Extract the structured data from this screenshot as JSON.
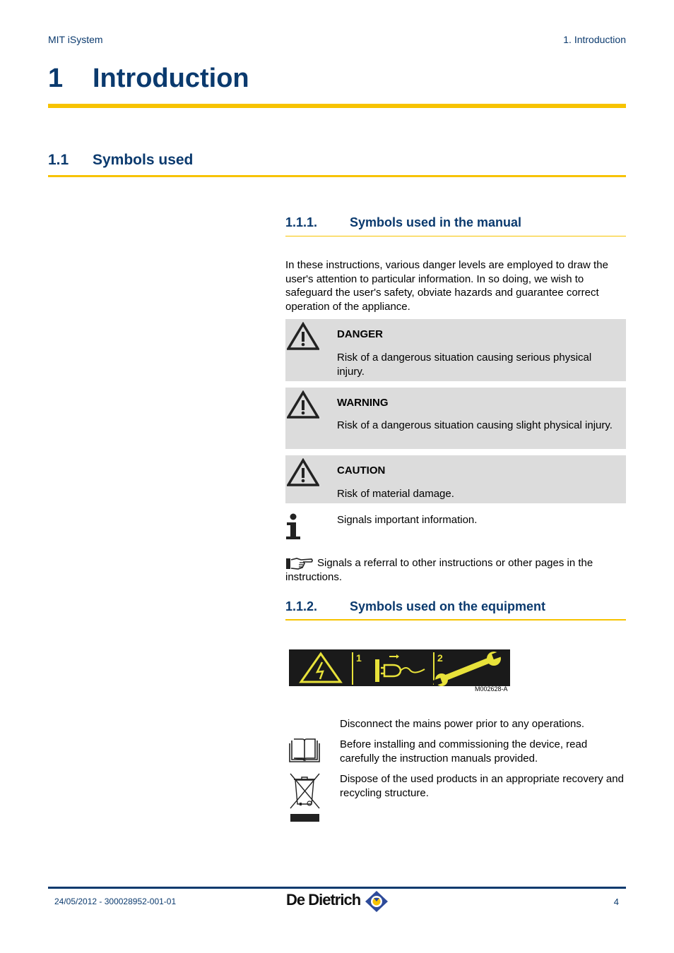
{
  "header": {
    "product": "MIT iSystem",
    "chapter": "1.  Introduction"
  },
  "chapter": {
    "number": "1",
    "title": "Introduction"
  },
  "section": {
    "number": "1.1",
    "title": "Symbols used"
  },
  "subsection1": {
    "number": "1.1.1.",
    "title": "Symbols used in the manual",
    "intro": "In these instructions, various danger levels are employed to draw the user's attention to particular information. In so doing, we wish to safeguard the user's safety, obviate hazards and guarantee correct operation of the appliance.",
    "notices": [
      {
        "icon": "warning-triangle-icon",
        "title": "DANGER",
        "text": "Risk of a dangerous situation causing serious physical injury."
      },
      {
        "icon": "warning-triangle-icon",
        "title": "WARNING",
        "text": "Risk of a dangerous situation causing slight physical injury."
      },
      {
        "icon": "warning-triangle-icon",
        "title": "CAUTION",
        "text": "Risk of material damage."
      }
    ],
    "info": {
      "icon": "info-icon",
      "text": "Signals important information."
    },
    "referral": {
      "icon": "pointing-hand-icon",
      "text": "Signals a referral to other instructions or other pages in the instructions."
    }
  },
  "subsection2": {
    "number": "1.1.2.",
    "title": "Symbols used on the equipment",
    "figure": {
      "label1": "1",
      "label2": "2",
      "code": "M002628-A",
      "colors": {
        "background": "#1a1a1a",
        "symbol": "#e8e23a"
      }
    },
    "items": [
      {
        "icon": "",
        "text": "Disconnect the mains power prior to any operations."
      },
      {
        "icon": "book-icon",
        "text": "Before installing and commissioning the device, read carefully the instruction manuals provided."
      },
      {
        "icon": "crossed-bin-icon",
        "text": "Dispose of the used products in an appropriate recovery and recycling structure."
      }
    ]
  },
  "footer": {
    "date_ref": "24/05/2012  - 300028952-001-01",
    "brand": "De Dietrich",
    "page": "4"
  },
  "colors": {
    "heading": "#0b3a6e",
    "accent": "#f7c300",
    "notice_bg": "#dcdcdc"
  }
}
